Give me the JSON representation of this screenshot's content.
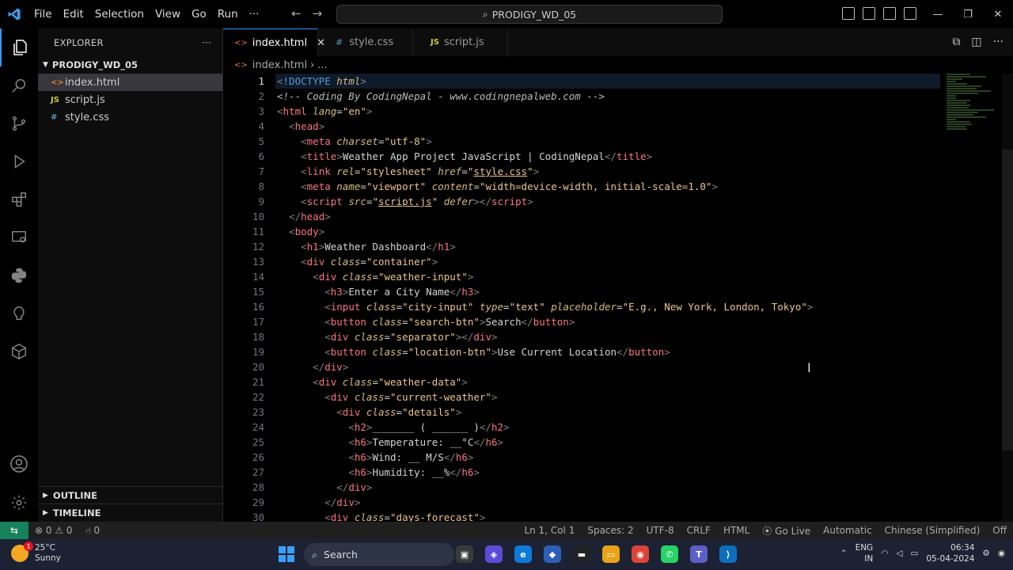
{
  "menu": [
    "File",
    "Edit",
    "Selection",
    "View",
    "Go",
    "Run",
    "···"
  ],
  "command_center": "PRODIGY_WD_05",
  "explorer": {
    "header": "EXPLORER",
    "more": "···",
    "folder": "PRODIGY_WD_05",
    "files": [
      {
        "icon": "<>",
        "name": "index.html",
        "color": "#e37933"
      },
      {
        "icon": "JS",
        "name": "script.js",
        "color": "#cbcb41"
      },
      {
        "icon": "#",
        "name": "style.css",
        "color": "#519aba"
      }
    ],
    "outline": "OUTLINE",
    "timeline": "TIMELINE"
  },
  "tabs": [
    {
      "icon": "<>",
      "name": "index.html",
      "close": "✕"
    },
    {
      "icon": "#",
      "name": "style.css"
    },
    {
      "icon": "JS",
      "name": "script.js"
    }
  ],
  "breadcrumb": {
    "file": "index.html",
    "rest": "..."
  },
  "line_numbers": [
    "1",
    "2",
    "3",
    "4",
    "5",
    "6",
    "7",
    "8",
    "9",
    "10",
    "11",
    "12",
    "13",
    "14",
    "15",
    "16",
    "17",
    "18",
    "19",
    "20",
    "21",
    "22",
    "23",
    "24",
    "25",
    "26",
    "27",
    "28",
    "29",
    "30"
  ],
  "statusbar": {
    "errors": "⊗ 0 ⚠ 0",
    "ports": "⑁ 0",
    "position": "Ln 1, Col 1",
    "spaces": "Spaces: 2",
    "encoding": "UTF-8",
    "eol": "CRLF",
    "language": "HTML",
    "golive": "⦿ Go Live",
    "formatter": "Automatic",
    "locale": "Chinese (Simplified)",
    "extra": "Off"
  },
  "taskbar": {
    "temp": "25°C",
    "condition": "Sunny",
    "badge": "1",
    "search": "Search",
    "lang1": "ENG",
    "lang2": "IN",
    "time": "06:34",
    "date": "05-04-2024"
  },
  "colors": {
    "accent": "#3794ff",
    "remote": "#16825d",
    "tag": "#f97583",
    "attribute": "#d7ba7d",
    "string": "#ecc48d"
  }
}
